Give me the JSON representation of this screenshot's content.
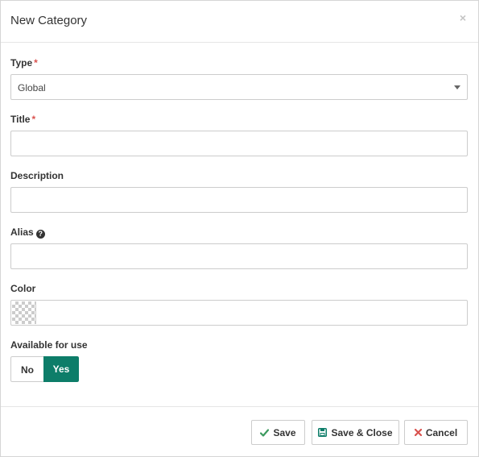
{
  "modal": {
    "title": "New Category",
    "close_symbol": "×"
  },
  "form": {
    "type": {
      "label": "Type",
      "required_mark": "*",
      "value": "Global"
    },
    "title": {
      "label": "Title",
      "required_mark": "*",
      "value": ""
    },
    "description": {
      "label": "Description",
      "value": ""
    },
    "alias": {
      "label": "Alias",
      "help_symbol": "?",
      "value": ""
    },
    "color": {
      "label": "Color",
      "value": ""
    },
    "available": {
      "label": "Available for use",
      "options": [
        "No",
        "Yes"
      ],
      "selected": "Yes"
    }
  },
  "footer": {
    "save_label": "Save",
    "save_close_label": "Save & Close",
    "cancel_label": "Cancel"
  },
  "colors": {
    "accent": "#0d7d69",
    "required": "#d9534f",
    "save_icon": "#3c9a5f",
    "save_close_icon": "#0d7d69",
    "cancel_icon": "#d9534f"
  },
  "icons": {
    "save": "check-icon",
    "save_close": "floppy-disk-icon",
    "cancel": "times-icon",
    "alias_help": "question-circle-icon",
    "type_dropdown": "caret-down-icon"
  }
}
